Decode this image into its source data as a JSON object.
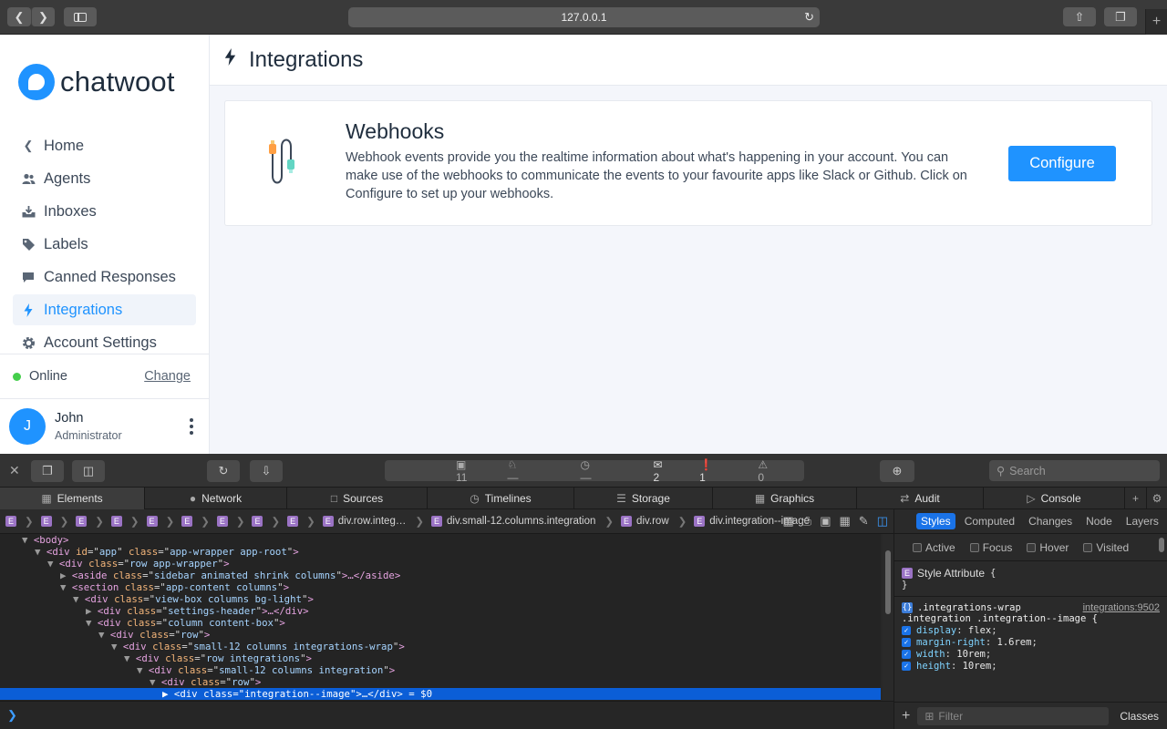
{
  "browser": {
    "url": "127.0.0.1",
    "back_icon": "chevron-left-icon",
    "forward_icon": "chevron-right-icon"
  },
  "sidebar": {
    "logo_text": "chatwoot",
    "items": [
      {
        "label": "Home",
        "icon": "chevron-left-icon"
      },
      {
        "label": "Agents",
        "icon": "people-icon"
      },
      {
        "label": "Inboxes",
        "icon": "inbox-icon"
      },
      {
        "label": "Labels",
        "icon": "tag-icon"
      },
      {
        "label": "Canned Responses",
        "icon": "chat-icon"
      },
      {
        "label": "Integrations",
        "icon": "flash-icon",
        "active": true
      },
      {
        "label": "Account Settings",
        "icon": "gear-icon"
      }
    ],
    "status": "Online",
    "change_label": "Change",
    "user": {
      "initial": "J",
      "name": "John",
      "role": "Administrator"
    }
  },
  "header": {
    "title": "Integrations"
  },
  "integration": {
    "title": "Webhooks",
    "description": "Webhook events provide you the realtime information about what's happening in your account. You can make use of the webhooks to communicate the events to your favourite apps like Slack or Github. Click on Configure to set up your webhooks.",
    "button_label": "Configure"
  },
  "devtools": {
    "status": {
      "resources": "11",
      "dash1": "—",
      "dash2": "—",
      "messages": "2",
      "errors": "1",
      "warnings": "0"
    },
    "search_placeholder": "Search",
    "tabs": [
      "Elements",
      "Network",
      "Sources",
      "Timelines",
      "Storage",
      "Graphics",
      "Audit",
      "Console"
    ],
    "breadcrumbs": [
      "div.row.integ…",
      "div.small-12.columns.integration",
      "div.row",
      "div.integration--image"
    ],
    "dom": [
      {
        "indent": 2,
        "tri": "▼",
        "text": "<body>"
      },
      {
        "indent": 3,
        "tri": "▼",
        "tag": "div",
        "attrs": [
          [
            "id",
            "app"
          ],
          [
            "class",
            "app-wrapper app-root"
          ]
        ],
        "close": ">"
      },
      {
        "indent": 4,
        "tri": "▼",
        "tag": "div",
        "attrs": [
          [
            "class",
            "row app-wrapper"
          ]
        ],
        "close": ">"
      },
      {
        "indent": 5,
        "tri": "▶",
        "tag": "aside",
        "attrs": [
          [
            "class",
            "sidebar animated shrink columns"
          ]
        ],
        "close": ">…</aside>"
      },
      {
        "indent": 5,
        "tri": "▼",
        "tag": "section",
        "attrs": [
          [
            "class",
            "app-content columns"
          ]
        ],
        "close": ">"
      },
      {
        "indent": 6,
        "tri": "▼",
        "tag": "div",
        "attrs": [
          [
            "class",
            "view-box columns bg-light"
          ]
        ],
        "close": ">"
      },
      {
        "indent": 7,
        "tri": "▶",
        "tag": "div",
        "attrs": [
          [
            "class",
            "settings-header"
          ]
        ],
        "close": ">…</div>"
      },
      {
        "indent": 7,
        "tri": "▼",
        "tag": "div",
        "attrs": [
          [
            "class",
            "column content-box"
          ]
        ],
        "close": ">"
      },
      {
        "indent": 8,
        "tri": "▼",
        "tag": "div",
        "attrs": [
          [
            "class",
            "row"
          ]
        ],
        "close": ">"
      },
      {
        "indent": 9,
        "tri": "▼",
        "tag": "div",
        "attrs": [
          [
            "class",
            "small-12 columns integrations-wrap"
          ]
        ],
        "close": ">"
      },
      {
        "indent": 10,
        "tri": "▼",
        "tag": "div",
        "attrs": [
          [
            "class",
            "row integrations"
          ]
        ],
        "close": ">"
      },
      {
        "indent": 11,
        "tri": "▼",
        "tag": "div",
        "attrs": [
          [
            "class",
            "small-12 columns integration"
          ]
        ],
        "close": ">"
      },
      {
        "indent": 12,
        "tri": "▼",
        "tag": "div",
        "attrs": [
          [
            "class",
            "row"
          ]
        ],
        "close": ">"
      },
      {
        "indent": 13,
        "tri": "▶",
        "tag": "div",
        "attrs": [
          [
            "class",
            "integration--image"
          ]
        ],
        "close": ">…</div> = $0",
        "selected": true
      }
    ],
    "styles": {
      "tabs": [
        "Styles",
        "Computed",
        "Changes",
        "Node",
        "Layers"
      ],
      "states": [
        "Active",
        "Focus",
        "Hover",
        "Visited"
      ],
      "style_attribute": "Style Attribute",
      "rule_selector_1": ".integrations-wrap",
      "rule_selector_2": ".integration .integration--image",
      "rule_source": "integrations:9502",
      "props": [
        {
          "name": "display",
          "value": "flex"
        },
        {
          "name": "margin-right",
          "value": "1.6rem"
        },
        {
          "name": "width",
          "value": "10rem"
        },
        {
          "name": "height",
          "value": "10rem"
        }
      ],
      "filter_placeholder": "Filter",
      "classes_label": "Classes"
    }
  }
}
